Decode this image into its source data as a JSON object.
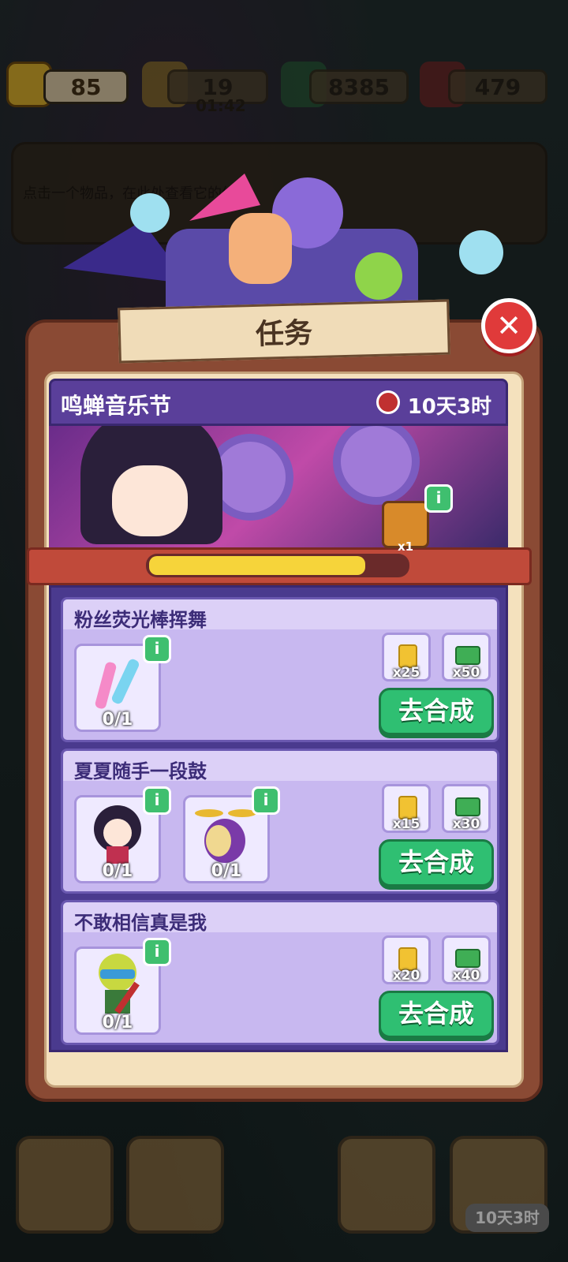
{
  "resources": {
    "tickets": "85",
    "energy": "19",
    "energy_timer": "01:42",
    "cash": "8385",
    "gems": "479"
  },
  "hint": "点击一个物品，在此处查看它的信息",
  "panel_title": "任务",
  "event": {
    "name": "鸣蝉音乐节",
    "time_left": "10天3时",
    "chest_count": "x1",
    "progress": 0.84
  },
  "tasks": [
    {
      "title": "粉丝荧光棒挥舞",
      "items": [
        {
          "icon": "glowstick-icon",
          "count": "0/1"
        }
      ],
      "rewards": [
        "x25",
        "x50"
      ],
      "button": "去合成"
    },
    {
      "title": "夏夏随手一段鼓",
      "items": [
        {
          "icon": "singer-girl-icon",
          "count": "0/1"
        },
        {
          "icon": "drum-kit-icon",
          "count": "0/1"
        }
      ],
      "rewards": [
        "x15",
        "x30"
      ],
      "button": "去合成"
    },
    {
      "title": "不敢相信真是我",
      "items": [
        {
          "icon": "guitarist-icon",
          "count": "0/1"
        }
      ],
      "rewards": [
        "x20",
        "x40"
      ],
      "button": "去合成"
    }
  ],
  "bottom_timer": "10天3时",
  "colors": {
    "accent_green": "#2fbf72",
    "close_red": "#e03a3a",
    "progress_yellow": "#f6d43a",
    "event_purple": "#5a3f9a"
  }
}
